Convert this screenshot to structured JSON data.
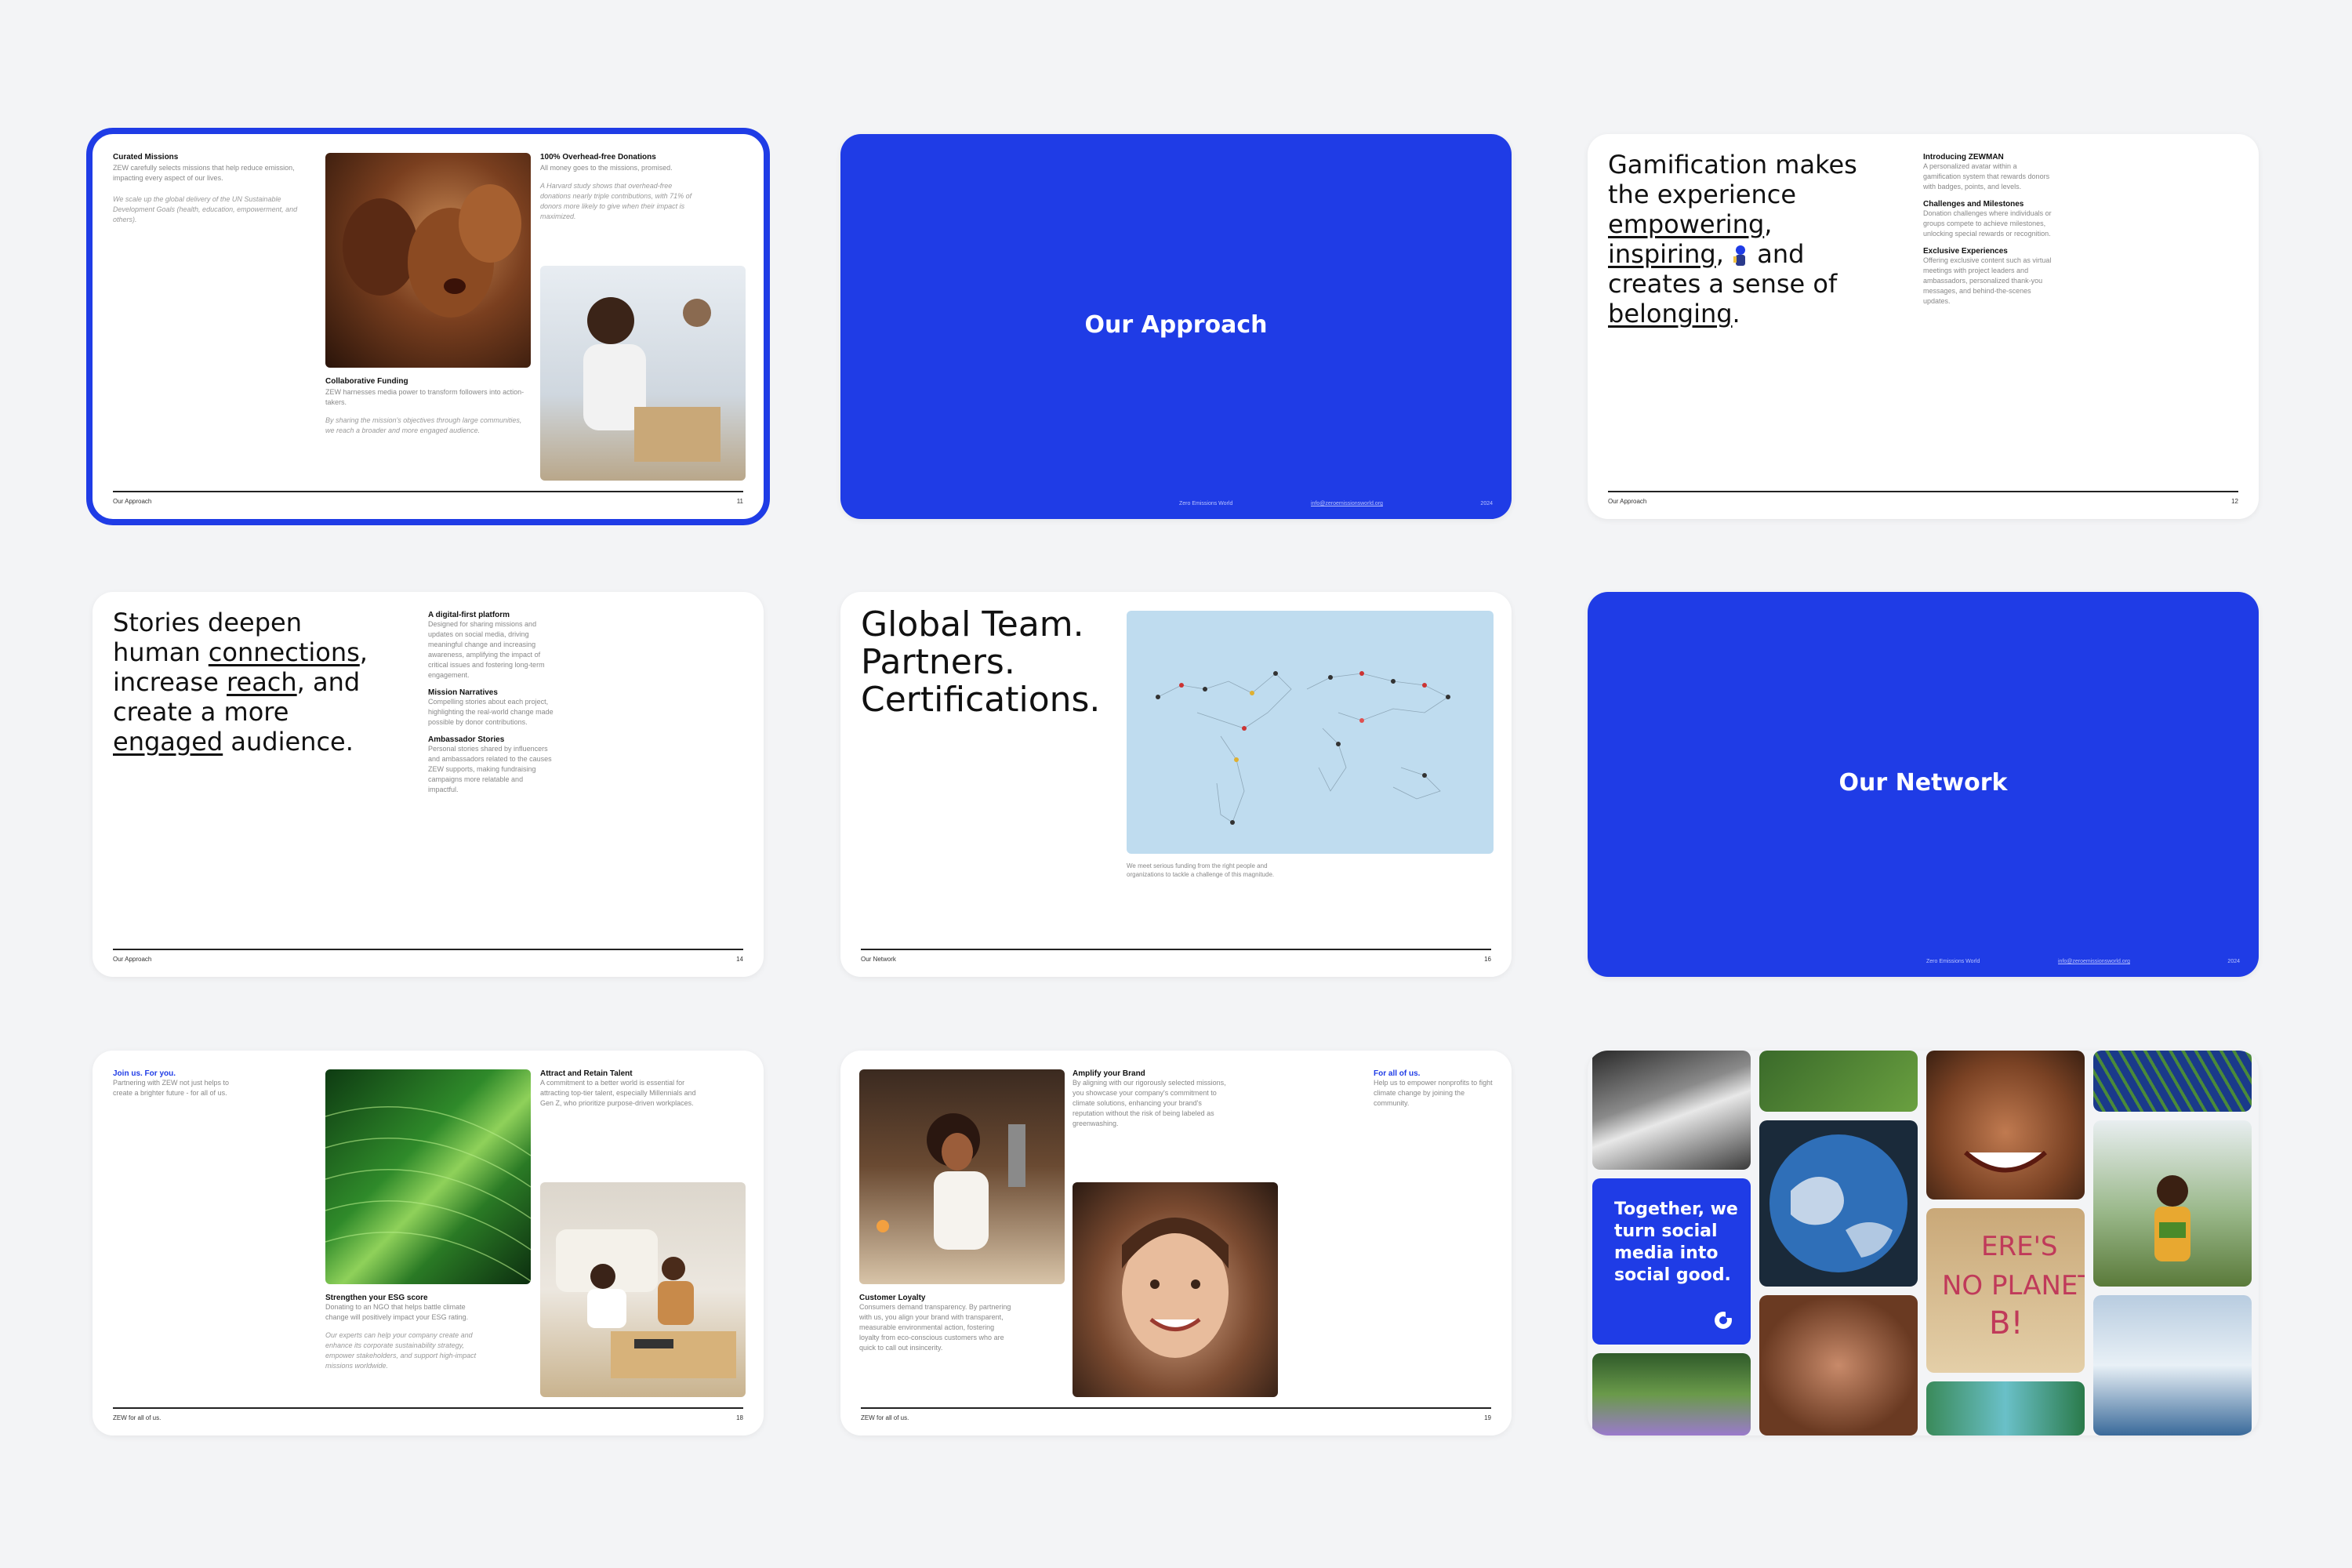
{
  "slides": {
    "s1": {
      "curated_title": "Curated Missions",
      "curated_text": "ZEW carefully selects missions that help reduce emission, impacting every aspect of our lives.",
      "curated_italic": "We scale up the global delivery of the UN Sustainable Development Goals (health, education, empowerment, and others).",
      "overhead_title": "100% Overhead-free Donations",
      "overhead_text": "All money goes to the missions, promised.",
      "overhead_italic": "A Harvard study shows that overhead-free donations nearly triple contributions, with 71% of donors more likely to give when their impact is maximized.",
      "collab_title": "Collaborative Funding",
      "collab_text": "ZEW harnesses media power to transform followers into action-takers.",
      "collab_italic": "By sharing the mission's objectives through large communities, we reach a broader and more engaged audience.",
      "footer_left": "Our Approach",
      "footer_right": "11"
    },
    "s2": {
      "title": "Our Approach",
      "foot_center": "Zero Emissions World",
      "foot_link": "info@zeroemissionsworld.org",
      "foot_year": "2024"
    },
    "s3": {
      "line1": "Gamification makes",
      "line2": "the experience",
      "w_empowering": "empowering",
      "w_inspiring": "inspiring",
      "w_and": "and",
      "line5": "creates a sense of",
      "w_belonging": "belonging",
      "intro_title": "Introducing ZEWMAN",
      "intro_text": "A personalized avatar within a gamification system that rewards donors with badges, points, and levels.",
      "chal_title": "Challenges and Milestones",
      "chal_text": "Donation challenges where individuals or groups compete to achieve milestones, unlocking special rewards or recognition.",
      "excl_title": "Exclusive Experiences",
      "excl_text": "Offering exclusive content such as virtual meetings with project leaders and ambassadors, personalized thank-you messages, and behind-the-scenes updates.",
      "footer_left": "Our Approach",
      "footer_right": "12"
    },
    "s4": {
      "line1": "Stories deepen",
      "line2a": "human",
      "w_connections": "connections",
      "line3a": "increase",
      "w_reach": "reach",
      "line3b": ", and",
      "line4": "create a more",
      "w_engaged": "engaged",
      "line5b": "audience.",
      "p1_title": "A digital-first platform",
      "p1_text": "Designed for sharing missions and updates on social media, driving meaningful change and increasing awareness, amplifying the impact of critical issues and fostering long-term engagement.",
      "p2_title": "Mission Narratives",
      "p2_text": "Compelling stories about each project, highlighting the real-world change made possible by donor contributions.",
      "p3_title": "Ambassador Stories",
      "p3_text": "Personal stories shared by influencers and ambassadors related to the causes ZEW supports, making fundraising campaigns more relatable and impactful.",
      "footer_left": "Our Approach",
      "footer_right": "14"
    },
    "s5": {
      "line1": "Global Team.",
      "line2": "Partners.",
      "line3": "Certifications.",
      "caption": "We meet serious funding from the right people and organizations to tackle a challenge of this magnitude.",
      "footer_left": "Our Network",
      "footer_right": "16"
    },
    "s6": {
      "title": "Our Network",
      "foot_center": "Zero Emissions World",
      "foot_link": "info@zeroemissionsworld.org",
      "foot_year": "2024"
    },
    "s7": {
      "join_title": "Join us. For you.",
      "join_text": "Partnering with ZEW not just helps to create a brighter future - for all of us.",
      "attract_title": "Attract and Retain Talent",
      "attract_text": "A commitment to a better world is essential for attracting top-tier talent, especially Millennials and Gen Z, who prioritize purpose-driven workplaces.",
      "esg_title": "Strengthen your ESG score",
      "esg_text": "Donating to an NGO that helps battle climate change will positively impact your ESG rating.",
      "esg_italic": "Our experts can help your company create and enhance its corporate sustainability strategy, empower stakeholders, and support high-impact missions worldwide.",
      "footer_left": "ZEW for all of us.",
      "footer_right": "18"
    },
    "s8": {
      "amp_title": "Amplify your Brand",
      "amp_text": "By aligning with our rigorously selected missions, you showcase your company's commitment to climate solutions, enhancing your brand's reputation without the risk of being labeled as greenwashing.",
      "for_all_title": "For all of us.",
      "for_all_text": "Help us to empower nonprofits to fight climate change by joining the community.",
      "loyal_title": "Customer Loyalty",
      "loyal_text": "Consumers demand transparency. By partnering with us, you align your brand with transparent, measurable environmental action, fostering loyalty from eco-conscious customers who are quick to call out insincerity.",
      "footer_left": "ZEW for all of us.",
      "footer_right": "19"
    },
    "s9": {
      "card_text": "Together, we turn social media into social good."
    }
  },
  "colors": {
    "accent": "#1f3ce6",
    "canvas": "#f3f4f6",
    "selection": "#1f3ce6"
  }
}
